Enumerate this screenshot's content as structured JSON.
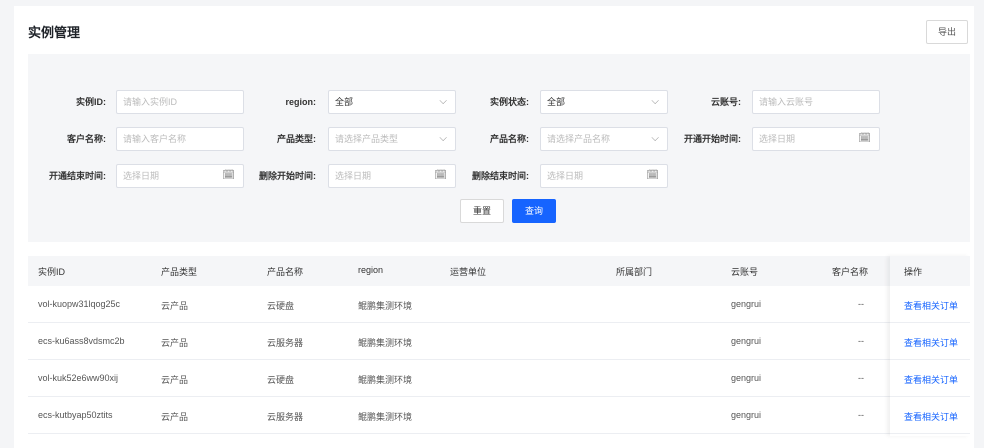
{
  "header": {
    "title": "实例管理",
    "export_label": "导出"
  },
  "filters": {
    "instance_id": {
      "label": "实例ID:",
      "placeholder": "请输入实例ID"
    },
    "region": {
      "label": "region:",
      "value": "全部"
    },
    "instance_status": {
      "label": "实例状态:",
      "value": "全部"
    },
    "cloud_account": {
      "label": "云账号:",
      "placeholder": "请输入云账号"
    },
    "customer_name": {
      "label": "客户名称:",
      "placeholder": "请输入客户名称"
    },
    "product_type": {
      "label": "产品类型:",
      "placeholder": "请选择产品类型"
    },
    "product_name": {
      "label": "产品名称:",
      "placeholder": "请选择产品名称"
    },
    "open_start": {
      "label": "开通开始时间:",
      "placeholder": "选择日期"
    },
    "open_end": {
      "label": "开通结束时间:",
      "placeholder": "选择日期"
    },
    "delete_start": {
      "label": "删除开始时间:",
      "placeholder": "选择日期"
    },
    "delete_end": {
      "label": "删除结束时间:",
      "placeholder": "选择日期"
    },
    "reset_label": "重置",
    "query_label": "查询"
  },
  "table": {
    "columns": [
      "实例ID",
      "产品类型",
      "产品名称",
      "region",
      "运营单位",
      "所属部门",
      "云账号",
      "客户名称",
      "操作"
    ],
    "rows": [
      {
        "id": "vol-kuopw31lqog25c",
        "type": "云产品",
        "name": "云硬盘",
        "region": "鲲鹏集测环境",
        "unit": "",
        "dept": "",
        "account": "gengrui",
        "customer": "--",
        "action": "查看相关订单"
      },
      {
        "id": "ecs-ku6ass8vdsmc2b",
        "type": "云产品",
        "name": "云服务器",
        "region": "鲲鹏集测环境",
        "unit": "",
        "dept": "",
        "account": "gengrui",
        "customer": "--",
        "action": "查看相关订单"
      },
      {
        "id": "vol-kuk52e6ww90xij",
        "type": "云产品",
        "name": "云硬盘",
        "region": "鲲鹏集测环境",
        "unit": "",
        "dept": "",
        "account": "gengrui",
        "customer": "--",
        "action": "查看相关订单"
      },
      {
        "id": "ecs-kutbyap50ztits",
        "type": "云产品",
        "name": "云服务器",
        "region": "鲲鹏集测环境",
        "unit": "",
        "dept": "",
        "account": "gengrui",
        "customer": "--",
        "action": "查看相关订单"
      }
    ]
  }
}
